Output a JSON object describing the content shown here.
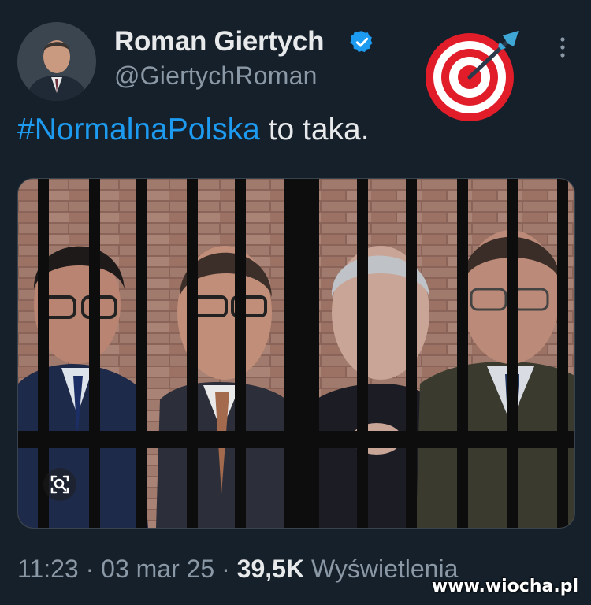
{
  "author": {
    "display_name": "Roman Giertych",
    "handle": "@GiertychRoman",
    "verified_icon": "verified-badge-icon",
    "avatar": "profile-photo"
  },
  "decoration": {
    "emoji": "direct-hit-target-icon"
  },
  "menu": {
    "icon": "more-options-icon"
  },
  "tweet": {
    "hashtag": "#NormalnaPolska",
    "text": " to taka."
  },
  "media": {
    "description_icon": "prison-bars-image",
    "lens_icon": "visual-search-icon"
  },
  "meta": {
    "time": "11:23",
    "sep1": " · ",
    "date": "03 mar 25",
    "sep2": " · ",
    "views": "39,5K",
    "views_label": " Wyświetlenia"
  },
  "watermark": "www.wiocha.pl",
  "colors": {
    "background": "#15202b",
    "hashtag": "#1d9bf0",
    "muted": "#8b98a5",
    "text": "#e7e9ea"
  }
}
